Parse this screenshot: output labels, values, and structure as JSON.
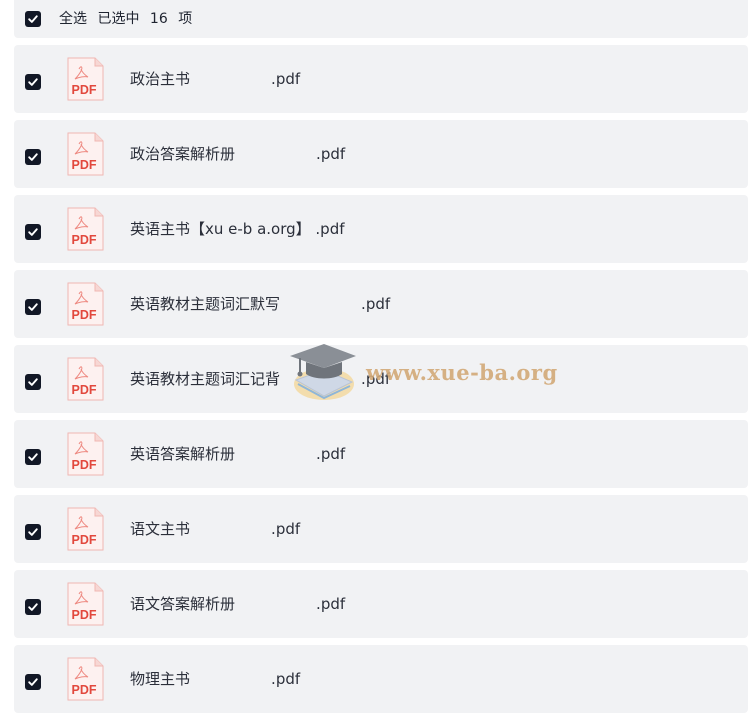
{
  "header": {
    "select_all_label": "全选",
    "selected_label": "已选中",
    "selected_count": "16",
    "unit_label": "项"
  },
  "files": [
    {
      "name": "政治主书                 .pdf",
      "icon": "pdf-file-icon",
      "checked": true
    },
    {
      "name": "政治答案解析册                 .pdf",
      "icon": "pdf-file-icon",
      "checked": true
    },
    {
      "name": "英语主书【xu e-b a.org】 .pdf",
      "icon": "pdf-file-icon",
      "checked": true
    },
    {
      "name": "英语教材主题词汇默写                 .pdf",
      "icon": "pdf-file-icon",
      "checked": true
    },
    {
      "name": "英语教材主题词汇记背                 .pdf",
      "icon": "pdf-file-icon",
      "checked": true
    },
    {
      "name": "英语答案解析册                 .pdf",
      "icon": "pdf-file-icon",
      "checked": true
    },
    {
      "name": "语文主书                 .pdf",
      "icon": "pdf-file-icon",
      "checked": true
    },
    {
      "name": "语文答案解析册                 .pdf",
      "icon": "pdf-file-icon",
      "checked": true
    },
    {
      "name": "物理主书                 .pdf",
      "icon": "pdf-file-icon",
      "checked": true
    }
  ],
  "icon_label": "PDF",
  "watermark": "www.xue-ba.org",
  "colors": {
    "row_bg": "#f1f2f4",
    "checkbox": "#121826",
    "pdf_red": "#e2483d",
    "watermark": "#d3a977"
  }
}
